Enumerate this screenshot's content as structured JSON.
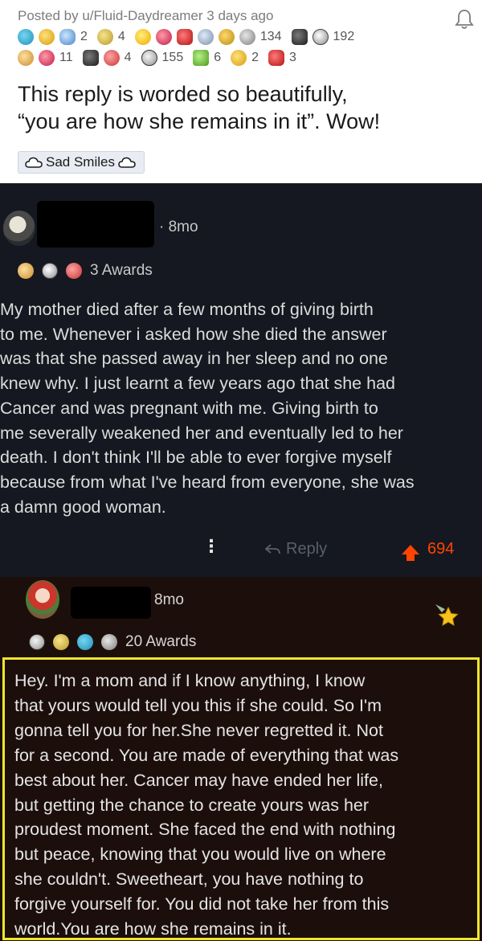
{
  "post": {
    "meta": "Posted by u/Fluid-Daydreamer 3 days ago",
    "awards_row1": [
      {
        "icon": "blue-orb-award-icon",
        "count": ""
      },
      {
        "icon": "yellow-face-award-icon",
        "count": ""
      },
      {
        "icon": "bubble-award-icon",
        "count": "2"
      },
      {
        "icon": "gold-shield-award-icon",
        "count": "4"
      },
      {
        "icon": "star-face-award-icon",
        "count": ""
      },
      {
        "icon": "heart-face-award-icon",
        "count": ""
      },
      {
        "icon": "red-creature-award-icon",
        "count": ""
      },
      {
        "icon": "silver-hand-award-icon",
        "count": ""
      },
      {
        "icon": "sparkle-award-icon",
        "count": ""
      },
      {
        "icon": "gray-face-award-icon",
        "count": "134"
      },
      {
        "icon": "black-creature-award-icon",
        "count": ""
      },
      {
        "icon": "smile-bubble-award-icon",
        "count": "192"
      }
    ],
    "awards_row2": [
      {
        "icon": "angel-award-icon",
        "count": ""
      },
      {
        "icon": "pink-heart-award-icon",
        "count": "11"
      },
      {
        "icon": "tv-award-icon",
        "count": ""
      },
      {
        "icon": "hands-award-icon",
        "count": "4"
      },
      {
        "icon": "silver-s-award-icon",
        "count": "155"
      },
      {
        "icon": "green-triangle-award-icon",
        "count": "6"
      },
      {
        "icon": "gold-coin-award-icon",
        "count": "2"
      },
      {
        "icon": "red-face-award-icon",
        "count": "3"
      }
    ],
    "title_line1": "This reply is worded so beautifully,",
    "title_line2": "“you are how she remains in it”. Wow!",
    "flair": "Sad Smiles"
  },
  "comment1": {
    "time": "· 8mo",
    "awards_label": "3 Awards",
    "award_icons": [
      "gold-person-award-icon",
      "wholesome-face-award-icon",
      "hands-award-icon"
    ],
    "lines": [
      "My mother died after a few months of giving birth",
      "to me. Whenever i asked how she died the answer",
      "was that she passed away in her sleep and no one",
      "knew why. I just learnt a few years ago that she had",
      "Cancer and was pregnant with me. Giving birth to",
      "me severally weakened her and eventually led to her",
      "death. I don't think I'll be able to ever forgive myself",
      "because from what I've heard from everyone, she was",
      "a damn good woman."
    ],
    "reply_label": "Reply",
    "score": "694",
    "colors": {
      "background": "#151820",
      "upvote": "#ff4500"
    }
  },
  "comment2": {
    "time": "8mo",
    "awards_label": "20 Awards",
    "award_icons": [
      "silver-s-award-icon",
      "gold-shield-award-icon",
      "blue-orb-award-icon",
      "gray-face-award-icon"
    ],
    "lines": [
      "Hey. I'm a mom and if I know anything, I know",
      "that yours would tell you this if she could. So I'm",
      "gonna tell you for her.She never regretted it. Not",
      "for a second. You are made of everything that was",
      "best about her. Cancer may have ended her life,",
      "but getting the chance to create yours was her",
      "proudest moment. She faced the end with nothing",
      "but peace, knowing that you would live on where",
      "she couldn't. Sweetheart, you have nothing to",
      "forgive yourself for.  You did not take her from this",
      "world.You are how she remains in it."
    ],
    "colors": {
      "background": "#1c0f0b",
      "highlight": "#f0e62a"
    }
  }
}
